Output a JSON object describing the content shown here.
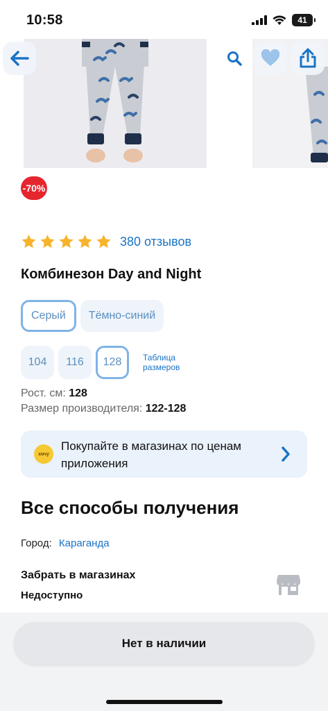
{
  "status_bar": {
    "time": "10:58",
    "battery": "41"
  },
  "product": {
    "discount": "-70%",
    "rating_stars": 5,
    "reviews_link": "380 отзывов",
    "title": "Комбинезон Day and Night",
    "colors": [
      "Серый",
      "Тёмно-синий"
    ],
    "selected_color": "Серый",
    "sizes": [
      "104",
      "116",
      "128"
    ],
    "selected_size": "128",
    "size_table_link": "Таблица размеров",
    "height_label": "Рост. см:",
    "height_value": "128",
    "manufacturer_size_label": "Размер производителя:",
    "manufacturer_size_value": "122-128"
  },
  "promo": {
    "badge": "хочу",
    "text": "Покупайте в магазинах по ценам приложения"
  },
  "delivery": {
    "heading": "Все способы получения",
    "city_label": "Город:",
    "city_value": "Караганда",
    "pickup_title": "Забрать в магазинах",
    "pickup_status": "Недоступно"
  },
  "cta": {
    "label": "Нет в наличии"
  },
  "colors": {
    "accent_blue": "#1a73c6",
    "star": "#f7b32b",
    "discount_red": "#e6262f"
  }
}
